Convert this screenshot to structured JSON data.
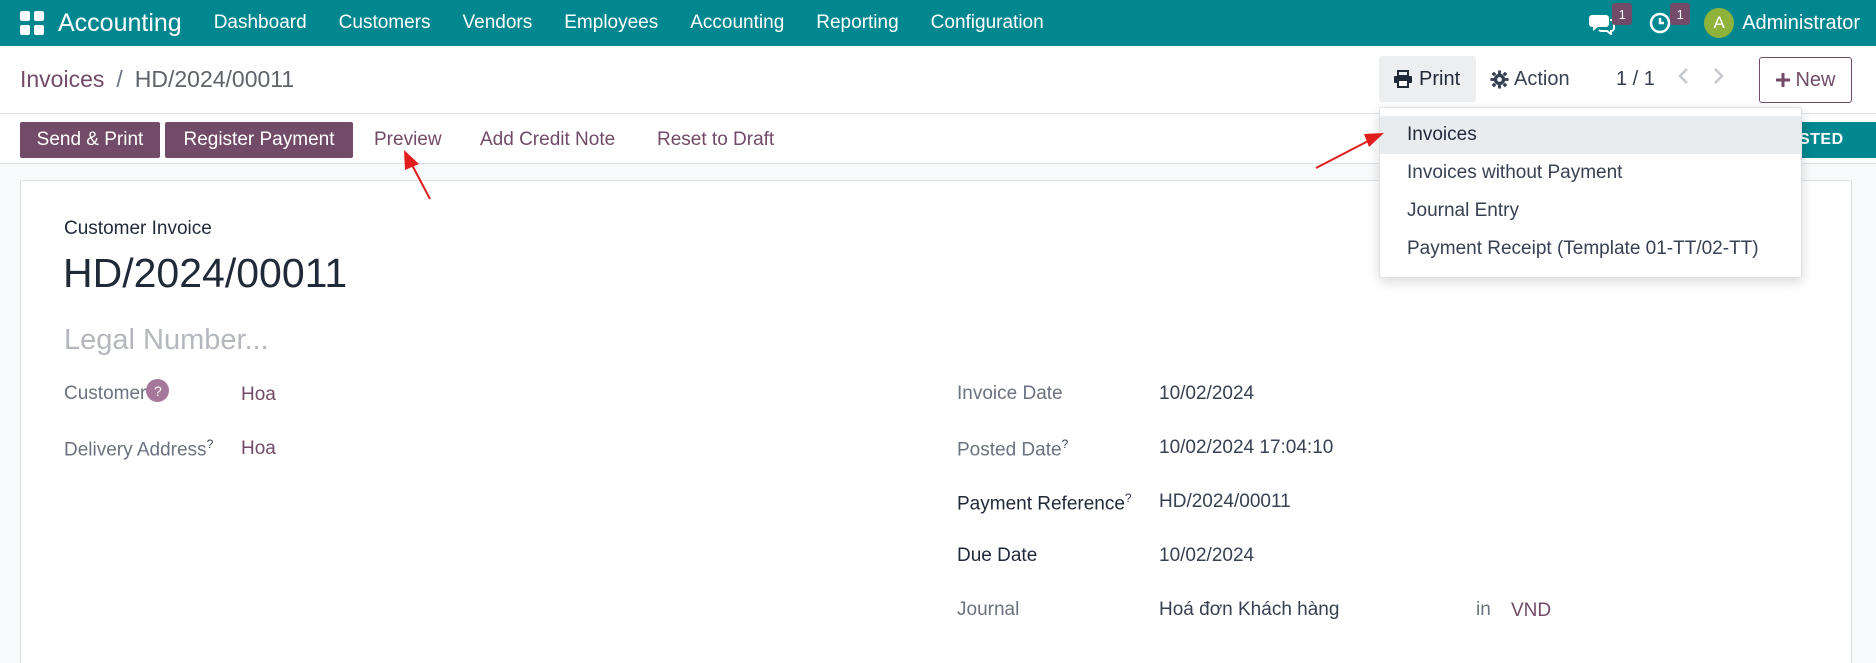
{
  "navbar": {
    "app_name": "Accounting",
    "menu": [
      "Dashboard",
      "Customers",
      "Vendors",
      "Employees",
      "Accounting",
      "Reporting",
      "Configuration"
    ],
    "messages_count": "1",
    "activities_count": "1",
    "avatar_letter": "A",
    "user_name": "Administrator"
  },
  "control": {
    "breadcrumb_parent": "Invoices",
    "breadcrumb_separator": "/",
    "breadcrumb_current": "HD/2024/00011",
    "print_label": "Print",
    "action_label": "Action",
    "pager": "1 / 1",
    "new_label": "New"
  },
  "statusbar": {
    "send_print": "Send & Print",
    "register_payment": "Register Payment",
    "preview": "Preview",
    "add_credit_note": "Add Credit Note",
    "reset_to_draft": "Reset to Draft",
    "status": "OSTED"
  },
  "print_menu": {
    "items": [
      "Invoices",
      "Invoices without Payment",
      "Journal Entry",
      "Payment Receipt (Template 01-TT/02-TT)"
    ]
  },
  "form": {
    "type_label": "Customer Invoice",
    "number": "HD/2024/00011",
    "legal_placeholder": "Legal Number...",
    "customer_label": "Customer",
    "customer_help": "?",
    "customer_value": "Hoa",
    "delivery_label": "Delivery Address",
    "delivery_help": "?",
    "delivery_value": "Hoa",
    "invoice_date_label": "Invoice Date",
    "invoice_date_value": "10/02/2024",
    "posted_date_label": "Posted Date",
    "posted_date_help": "?",
    "posted_date_value": "10/02/2024 17:04:10",
    "payment_ref_label": "Payment Reference",
    "payment_ref_help": "?",
    "payment_ref_value": "HD/2024/00011",
    "due_date_label": "Due Date",
    "due_date_value": "10/02/2024",
    "journal_label": "Journal",
    "journal_value": "Hoá đơn Khách hàng",
    "journal_in": "in",
    "currency_value": "VND"
  },
  "colors": {
    "navbar": "#00878f",
    "brand": "#714b67",
    "annotation_arrow": "#e11d1d"
  },
  "icons": [
    "apps-grid-icon",
    "chat-icon",
    "clock-icon",
    "printer-icon",
    "gear-icon",
    "chevron-left-icon",
    "chevron-right-icon",
    "plus-icon"
  ]
}
